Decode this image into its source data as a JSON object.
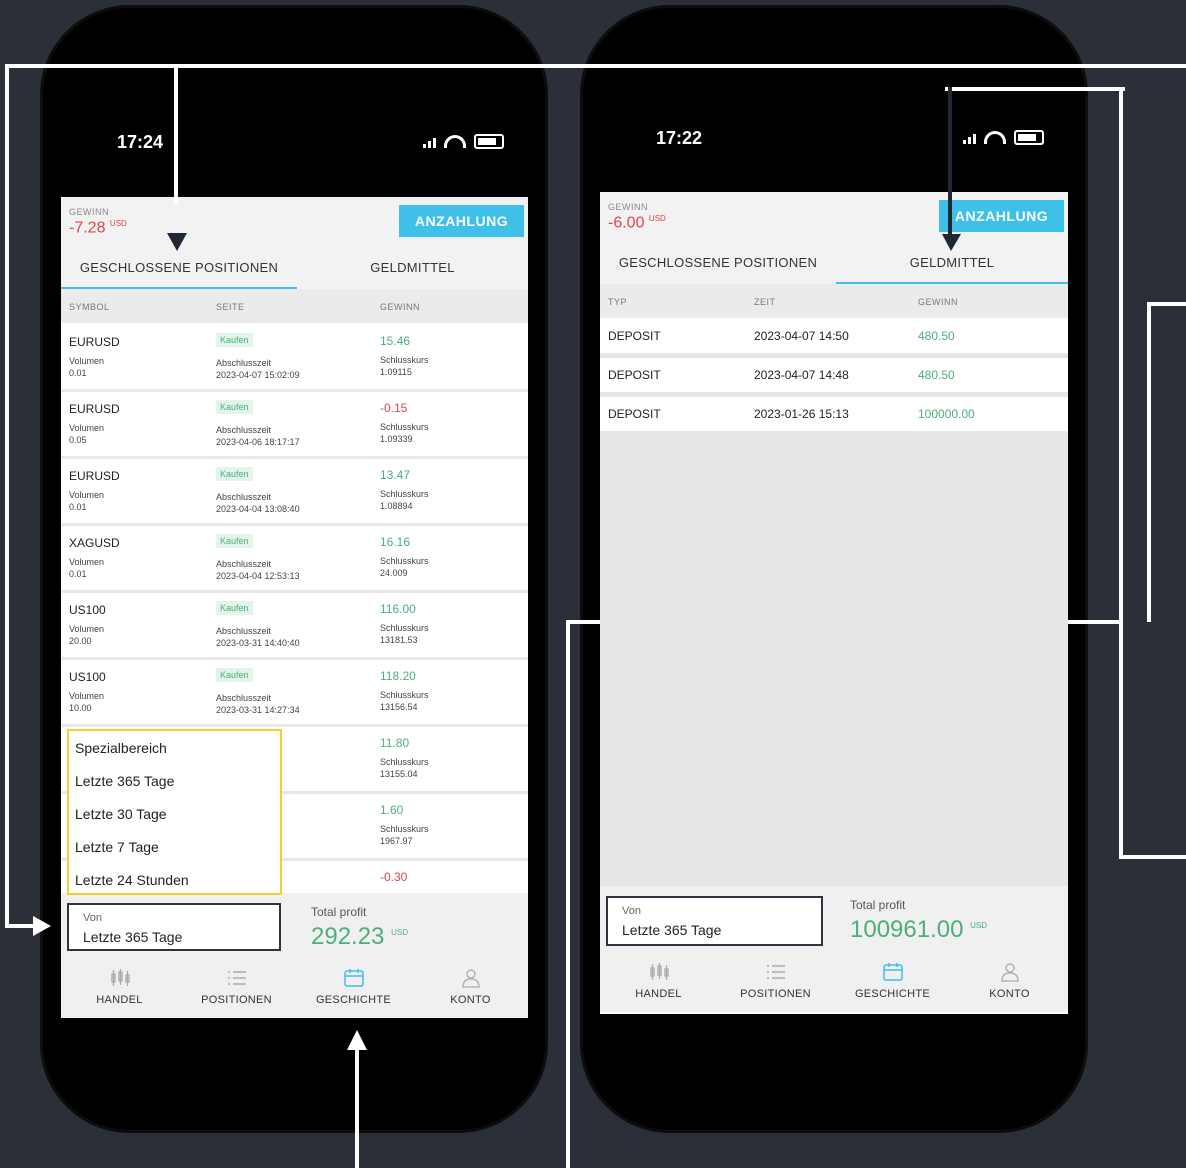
{
  "left": {
    "status_time": "17:24",
    "gain_label": "GEWINN",
    "gain_value": "-7.28",
    "gain_unit": "USD",
    "deposit_button": "ANZAHLUNG",
    "tabs": [
      "GESCHLOSSENE POSITIONEN",
      "GELDMITTEL"
    ],
    "active_tab": 0,
    "columns": [
      "SYMBOL",
      "SEITE",
      "GEWINN"
    ],
    "rows": [
      {
        "symbol": "EURUSD",
        "volume_label": "Volumen",
        "volume": "0.01",
        "side": "Kaufen",
        "time_label": "Abschlusszeit",
        "time": "2023-04-07 15:02:09",
        "gain": "15.46",
        "close_label": "Schlusskurs",
        "close": "1.09115"
      },
      {
        "symbol": "EURUSD",
        "volume_label": "Volumen",
        "volume": "0.05",
        "side": "Kaufen",
        "time_label": "Abschlusszeit",
        "time": "2023-04-06 18:17:17",
        "gain": "-0.15",
        "close_label": "Schlusskurs",
        "close": "1.09339"
      },
      {
        "symbol": "EURUSD",
        "volume_label": "Volumen",
        "volume": "0.01",
        "side": "Kaufen",
        "time_label": "Abschlusszeit",
        "time": "2023-04-04 13:08:40",
        "gain": "13.47",
        "close_label": "Schlusskurs",
        "close": "1.08894"
      },
      {
        "symbol": "XAGUSD",
        "volume_label": "Volumen",
        "volume": "0.01",
        "side": "Kaufen",
        "time_label": "Abschlusszeit",
        "time": "2023-04-04 12:53:13",
        "gain": "16.16",
        "close_label": "Schlusskurs",
        "close": "24.009"
      },
      {
        "symbol": "US100",
        "volume_label": "Volumen",
        "volume": "20.00",
        "side": "Kaufen",
        "time_label": "Abschlusszeit",
        "time": "2023-03-31 14:40:40",
        "gain": "116.00",
        "close_label": "Schlusskurs",
        "close": "13181.53"
      },
      {
        "symbol": "US100",
        "volume_label": "Volumen",
        "volume": "10.00",
        "side": "Kaufen",
        "time_label": "Abschlusszeit",
        "time": "2023-03-31 14:27:34",
        "gain": "118.20",
        "close_label": "Schlusskurs",
        "close": "13156.54"
      },
      {
        "symbol": "",
        "volume_label": "",
        "volume": "",
        "side": "",
        "time_label": "",
        "time": ":22:28",
        "gain": "11.80",
        "close_label": "Schlusskurs",
        "close": "13155.04"
      },
      {
        "symbol": "",
        "volume_label": "",
        "volume": "",
        "side": "",
        "time_label": "",
        "time": ":59:51",
        "gain": "1.60",
        "close_label": "Schlusskurs",
        "close": "1967.97"
      },
      {
        "symbol": "",
        "volume_label": "",
        "volume": "",
        "side": "",
        "time_label": "",
        "time": "",
        "gain": "-0.30",
        "close_label": "",
        "close": ""
      }
    ],
    "dropdown": [
      "Spezialbereich",
      "Letzte 365 Tage",
      "Letzte 30 Tage",
      "Letzte 7 Tage",
      "Letzte 24 Stunden"
    ],
    "from_label": "Von",
    "from_value": "Letzte 365 Tage",
    "total_profit_label": "Total profit",
    "total_profit_value": "292.23",
    "total_profit_unit": "USD",
    "nav": [
      "HANDEL",
      "POSITIONEN",
      "GESCHICHTE",
      "KONTO"
    ],
    "nav_active": 2
  },
  "right": {
    "status_time": "17:22",
    "gain_label": "GEWINN",
    "gain_value": "-6.00",
    "gain_unit": "USD",
    "deposit_button": "ANZAHLUNG",
    "tabs": [
      "GESCHLOSSENE POSITIONEN",
      "GELDMITTEL"
    ],
    "active_tab": 1,
    "columns": [
      "TYP",
      "ZEIT",
      "GEWINN"
    ],
    "rows": [
      {
        "type": "DEPOSIT",
        "time": "2023-04-07 14:50",
        "gain": "480.50"
      },
      {
        "type": "DEPOSIT",
        "time": "2023-04-07 14:48",
        "gain": "480.50"
      },
      {
        "type": "DEPOSIT",
        "time": "2023-01-26 15:13",
        "gain": "100000.00"
      }
    ],
    "from_label": "Von",
    "from_value": "Letzte 365 Tage",
    "total_profit_label": "Total profit",
    "total_profit_value": "100961.00",
    "total_profit_unit": "USD",
    "nav": [
      "HANDEL",
      "POSITIONEN",
      "GESCHICHTE",
      "KONTO"
    ],
    "nav_active": 2
  },
  "colors": {
    "accent": "#3ec0e8",
    "positive": "#4caf7b",
    "negative": "#e0444b",
    "dropdown_border": "#f2d12e"
  }
}
